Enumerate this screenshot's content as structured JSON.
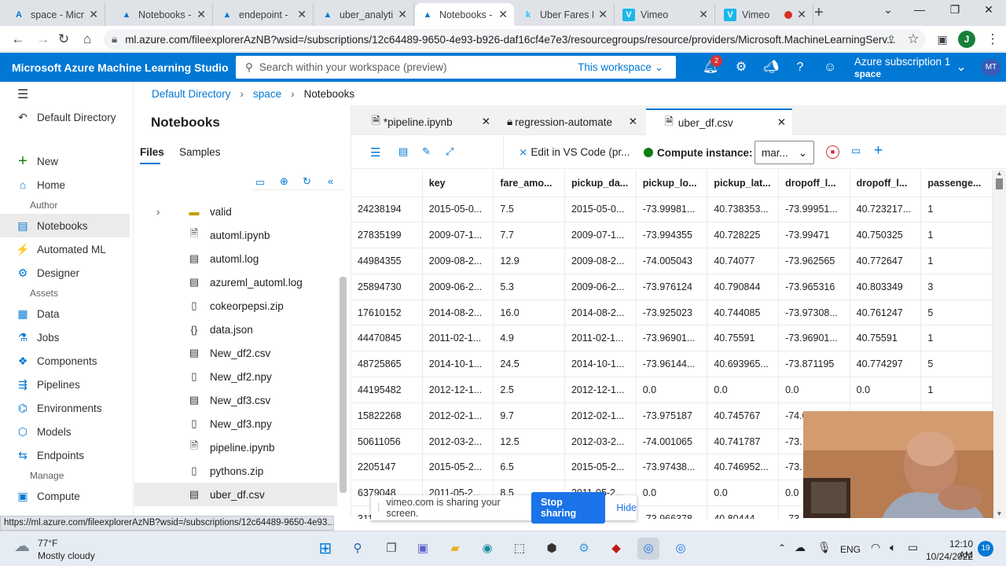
{
  "browser": {
    "tabs": [
      {
        "label": "space - Micro",
        "icon": "azure-icon"
      },
      {
        "label": "Notebooks -",
        "icon": "azure-ml-icon"
      },
      {
        "label": "endepoint -",
        "icon": "azure-ml-icon"
      },
      {
        "label": "uber_analytic",
        "icon": "azure-ml-icon"
      },
      {
        "label": "Notebooks -",
        "icon": "azure-ml-icon",
        "active": true
      },
      {
        "label": "Uber Fares D",
        "icon": "kaggle-icon"
      },
      {
        "label": "Vimeo",
        "icon": "vimeo-icon"
      },
      {
        "label": "Vimeo",
        "icon": "vimeo-icon"
      }
    ],
    "url": "ml.azure.com/fileexplorerAzNB?wsid=/subscriptions/12c64489-9650-4e93-b926-daf16cf4e7e3/resourcegroups/resource/providers/Microsoft.MachineLearningServ...",
    "profile_initial": "J",
    "status_url": "https://ml.azure.com/fileexplorerAzNB?wsid=/subscriptions/12c64489-9650-4e93..."
  },
  "azure": {
    "brand": "Microsoft Azure Machine Learning Studio",
    "search_placeholder": "Search within your workspace (preview)",
    "scope": "This workspace",
    "notifications": "2",
    "subscription": "Azure subscription 1",
    "workspace": "space",
    "avatar": "MT"
  },
  "leftnav": {
    "directory": "Default Directory",
    "items_top": [
      {
        "label": "New",
        "icon": "plus-icon"
      },
      {
        "label": "Home",
        "icon": "home-icon"
      }
    ],
    "section_author": "Author",
    "items_author": [
      {
        "label": "Notebooks",
        "icon": "notebook-icon",
        "selected": true
      },
      {
        "label": "Automated ML",
        "icon": "automl-icon"
      },
      {
        "label": "Designer",
        "icon": "designer-icon"
      }
    ],
    "section_assets": "Assets",
    "items_assets": [
      {
        "label": "Data",
        "icon": "data-icon"
      },
      {
        "label": "Jobs",
        "icon": "jobs-icon"
      },
      {
        "label": "Components",
        "icon": "components-icon"
      },
      {
        "label": "Pipelines",
        "icon": "pipelines-icon"
      },
      {
        "label": "Environments",
        "icon": "environments-icon"
      },
      {
        "label": "Models",
        "icon": "models-icon"
      },
      {
        "label": "Endpoints",
        "icon": "endpoints-icon"
      }
    ],
    "section_manage": "Manage",
    "items_manage": [
      {
        "label": "Compute",
        "icon": "compute-icon"
      }
    ]
  },
  "breadcrumb": [
    "Default Directory",
    "space",
    "Notebooks"
  ],
  "filepanel": {
    "title": "Notebooks",
    "tabs": [
      "Files",
      "Samples"
    ],
    "files": [
      {
        "name": "valid",
        "icon": "folder-icon"
      },
      {
        "name": "automl.ipynb",
        "icon": "notebook-file-icon"
      },
      {
        "name": "automl.log",
        "icon": "text-file-icon"
      },
      {
        "name": "azureml_automl.log",
        "icon": "text-file-icon"
      },
      {
        "name": "cokeorpepsi.zip",
        "icon": "zip-file-icon"
      },
      {
        "name": "data.json",
        "icon": "json-file-icon"
      },
      {
        "name": "New_df2.csv",
        "icon": "text-file-icon"
      },
      {
        "name": "New_df2.npy",
        "icon": "file-icon"
      },
      {
        "name": "New_df3.csv",
        "icon": "text-file-icon"
      },
      {
        "name": "New_df3.npy",
        "icon": "file-icon"
      },
      {
        "name": "pipeline.ipynb",
        "icon": "notebook-file-icon"
      },
      {
        "name": "pythons.zip",
        "icon": "zip-file-icon"
      },
      {
        "name": "uber_df.csv",
        "icon": "text-file-icon",
        "selected": true
      }
    ]
  },
  "editor": {
    "tabs": [
      {
        "label": "*pipeline.ipynb"
      },
      {
        "label": "regression-automate"
      },
      {
        "label": "uber_df.csv",
        "active": true
      }
    ],
    "vscode_label": "Edit in VS Code (pr...",
    "compute_label": "Compute instance:",
    "compute_value": "mar..."
  },
  "table": {
    "columns": [
      "",
      "key",
      "fare_amo...",
      "pickup_da...",
      "pickup_lo...",
      "pickup_lat...",
      "dropoff_l...",
      "dropoff_l...",
      "passenge..."
    ],
    "rows": [
      [
        "24238194",
        "2015-05-0...",
        "7.5",
        "2015-05-0...",
        "-73.99981...",
        "40.738353...",
        "-73.99951...",
        "40.723217...",
        "1"
      ],
      [
        "27835199",
        "2009-07-1...",
        "7.7",
        "2009-07-1...",
        "-73.994355",
        "40.728225",
        "-73.99471",
        "40.750325",
        "1"
      ],
      [
        "44984355",
        "2009-08-2...",
        "12.9",
        "2009-08-2...",
        "-74.005043",
        "40.74077",
        "-73.962565",
        "40.772647",
        "1"
      ],
      [
        "25894730",
        "2009-06-2...",
        "5.3",
        "2009-06-2...",
        "-73.976124",
        "40.790844",
        "-73.965316",
        "40.803349",
        "3"
      ],
      [
        "17610152",
        "2014-08-2...",
        "16.0",
        "2014-08-2...",
        "-73.925023",
        "40.744085",
        "-73.97308...",
        "40.761247",
        "5"
      ],
      [
        "44470845",
        "2011-02-1...",
        "4.9",
        "2011-02-1...",
        "-73.96901...",
        "40.75591",
        "-73.96901...",
        "40.75591",
        "1"
      ],
      [
        "48725865",
        "2014-10-1...",
        "24.5",
        "2014-10-1...",
        "-73.96144...",
        "40.693965...",
        "-73.871195",
        "40.774297",
        "5"
      ],
      [
        "44195482",
        "2012-12-1...",
        "2.5",
        "2012-12-1...",
        "0.0",
        "0.0",
        "0.0",
        "0.0",
        "1"
      ],
      [
        "15822268",
        "2012-02-1...",
        "9.7",
        "2012-02-1...",
        "-73.975187",
        "40.745767",
        "-74.0",
        "",
        ""
      ],
      [
        "50611056",
        "2012-03-2...",
        "12.5",
        "2012-03-2...",
        "-74.001065",
        "40.741787",
        "-73.",
        "",
        ""
      ],
      [
        "2205147",
        "2015-05-2...",
        "6.5",
        "2015-05-2...",
        "-73.97438...",
        "40.746952...",
        "-73.",
        "",
        ""
      ],
      [
        "6379048",
        "2011-05-2...",
        "8.5",
        "2011-05-2...",
        "0.0",
        "0.0",
        "0.0",
        "",
        ""
      ],
      [
        "311",
        "",
        "",
        "",
        "-73.966378",
        "40.80444",
        "-73.",
        "",
        ""
      ]
    ]
  },
  "share": {
    "text": "vimeo.com is sharing your screen.",
    "stop": "Stop sharing",
    "hide": "Hide"
  },
  "taskbar": {
    "temp": "77°F",
    "weather": "Mostly cloudy",
    "lang": "ENG",
    "time": "12:10 AM",
    "date": "10/24/2022",
    "badge": "19"
  }
}
